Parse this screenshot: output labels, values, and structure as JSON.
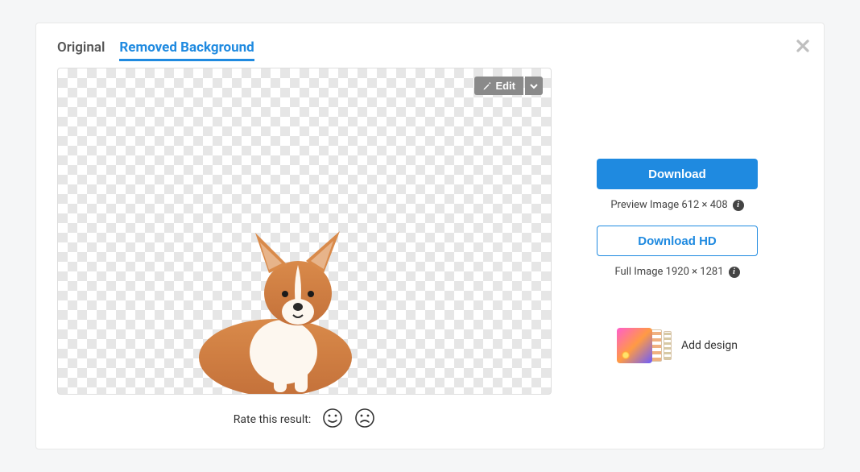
{
  "tabs": {
    "original": "Original",
    "removed": "Removed Background"
  },
  "edit": {
    "label": "Edit"
  },
  "rate": {
    "label": "Rate this result:"
  },
  "right": {
    "download": "Download",
    "preview_meta": "Preview Image 612 × 408",
    "download_hd": "Download HD",
    "full_meta": "Full Image 1920 × 1281",
    "add_design": "Add design"
  },
  "subject": {
    "kind": "dog-corgi",
    "position": "lower-left"
  }
}
